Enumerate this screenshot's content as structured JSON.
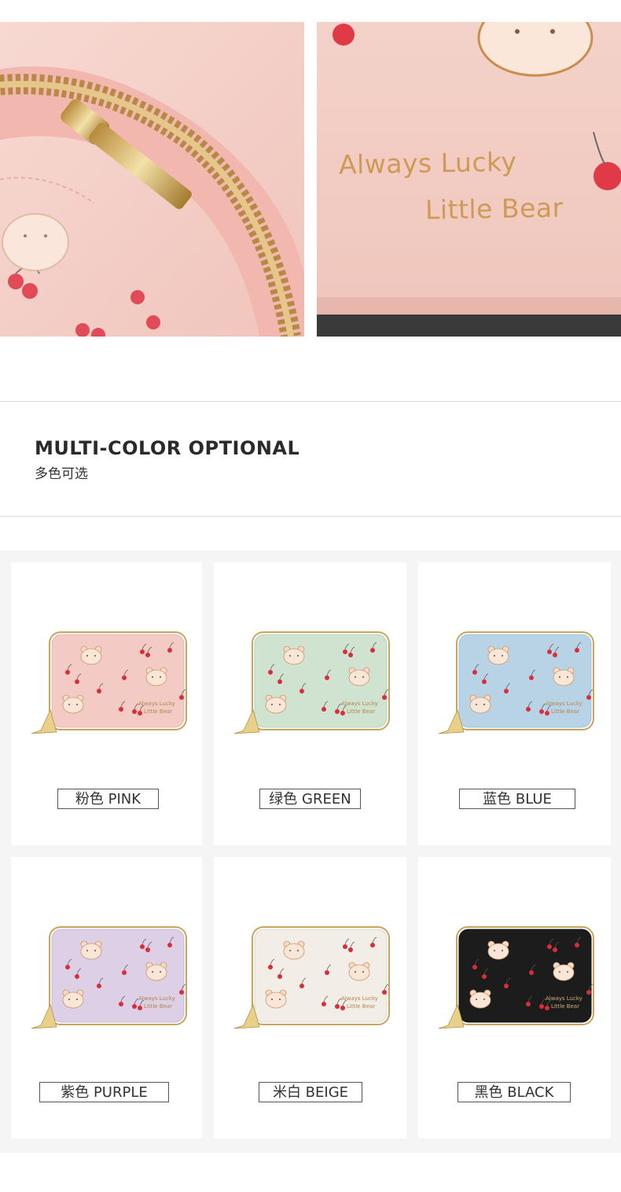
{
  "top_photos": {
    "right_emboss_line1": "Always Lucky",
    "right_emboss_line2": "Little Bear"
  },
  "section": {
    "title": "MULTI-COLOR OPTIONAL",
    "subtitle": "多色可选"
  },
  "wallet_print": {
    "line1": "Always Lucky",
    "line2": "Little Bear"
  },
  "colors": [
    {
      "label": "粉色 PINK",
      "hex": "#f3cbc4",
      "edge": "#e8b8b0"
    },
    {
      "label": "绿色 GREEN",
      "hex": "#cfe3d0",
      "edge": "#b9d1bb"
    },
    {
      "label": "蓝色 BLUE",
      "hex": "#b9d3e6",
      "edge": "#a4c0d6"
    },
    {
      "label": "紫色 PURPLE",
      "hex": "#ddcfe6",
      "edge": "#c9b8d6"
    },
    {
      "label": "米白 BEIGE",
      "hex": "#f2ede6",
      "edge": "#ddd6cc"
    },
    {
      "label": "黑色 BLACK",
      "hex": "#1c1c1c",
      "edge": "#111111"
    }
  ]
}
